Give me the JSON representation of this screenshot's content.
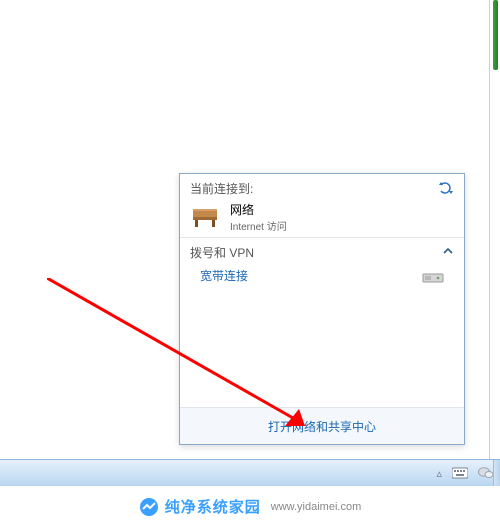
{
  "flyout": {
    "heading": "当前连接到:",
    "connection": {
      "name": "网络",
      "status": "Internet 访问"
    },
    "dialup_heading": "拨号和 VPN",
    "dialup_item": "宽带连接",
    "open_center": "打开网络和共享中心"
  },
  "tray": {
    "chevron": "▵"
  },
  "watermark": {
    "text": "纯净系统家园",
    "url": "www.yidaimei.com"
  }
}
